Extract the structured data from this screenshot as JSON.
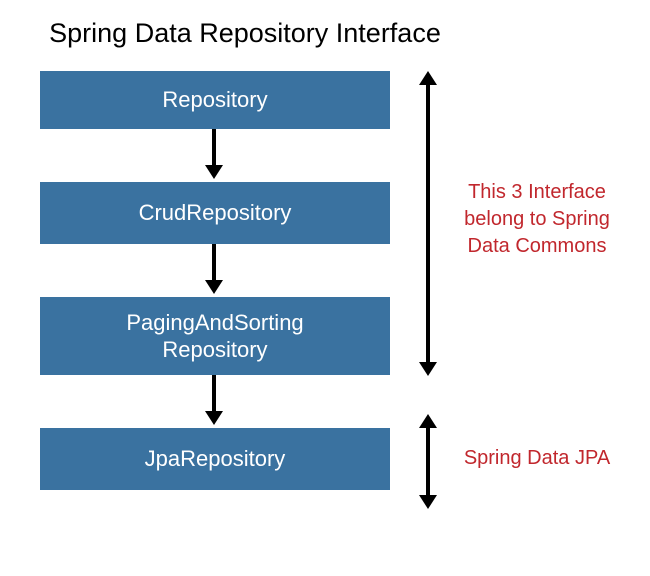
{
  "title": "Spring Data Repository Interface",
  "boxes": [
    {
      "label": "Repository"
    },
    {
      "label": "CrudRepository"
    },
    {
      "label_line1": "PagingAndSorting",
      "label_line2": "Repository"
    },
    {
      "label": "JpaRepository"
    }
  ],
  "annotations": {
    "commons_line1": "This 3 Interface",
    "commons_line2": "belong to Spring",
    "commons_line3": "Data Commons",
    "jpa": "Spring Data JPA"
  },
  "colors": {
    "box_bg": "#3a72a0",
    "box_text": "#ffffff",
    "annotation_text": "#c1272d"
  }
}
